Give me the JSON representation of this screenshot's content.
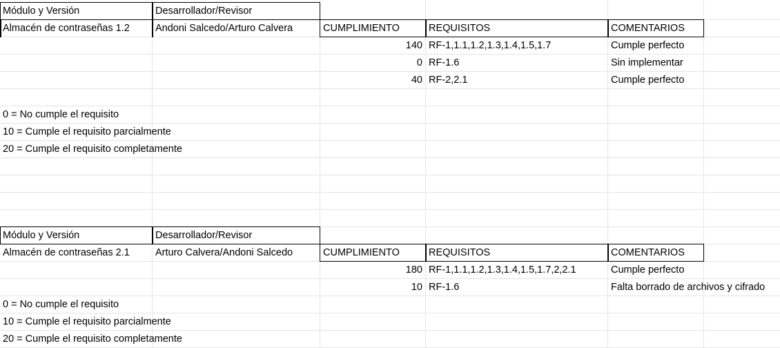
{
  "table1": {
    "header": {
      "modulo": "Módulo y Versión",
      "dev": "Desarrollador/Revisor"
    },
    "modulo": "Almacén de contraseñas 1.2",
    "dev": "Andoni Salcedo/Arturo Calvera",
    "col_headers": {
      "cumplimiento": "CUMPLIMIENTO",
      "requisitos": "REQUISITOS",
      "comentarios": "COMENTARIOS"
    },
    "rows": [
      {
        "value": "140",
        "req": "RF-1,1.1,1.2,1.3,1.4,1.5,1.7",
        "comment": "Cumple perfecto"
      },
      {
        "value": "0",
        "req": "RF-1.6",
        "comment": "Sin implementar"
      },
      {
        "value": "40",
        "req": "RF-2,2.1",
        "comment": "Cumple perfecto"
      }
    ],
    "legend": [
      "0 = No cumple el requisito",
      "10 = Cumple el requisito parcialmente",
      "20 = Cumple el requisito completamente"
    ]
  },
  "table2": {
    "header": {
      "modulo": "Módulo y Versión",
      "dev": "Desarrollador/Revisor"
    },
    "modulo": "Almacén de contraseñas 2.1",
    "dev": "Arturo Calvera/Andoni Salcedo",
    "col_headers": {
      "cumplimiento": "CUMPLIMIENTO",
      "requisitos": "REQUISITOS",
      "comentarios": "COMENTARIOS"
    },
    "rows": [
      {
        "value": "180",
        "req": "RF-1,1.1,1.2,1.3,1.4,1.5,1.7,2,2.1",
        "comment": "Cumple perfecto"
      },
      {
        "value": "10",
        "req": "RF-1.6",
        "comment": "Falta borrado de archivos y cifrado"
      }
    ],
    "legend": [
      "0 = No cumple el requisito",
      "10 = Cumple el requisito parcialmente",
      "20 = Cumple el requisito completamente"
    ]
  }
}
